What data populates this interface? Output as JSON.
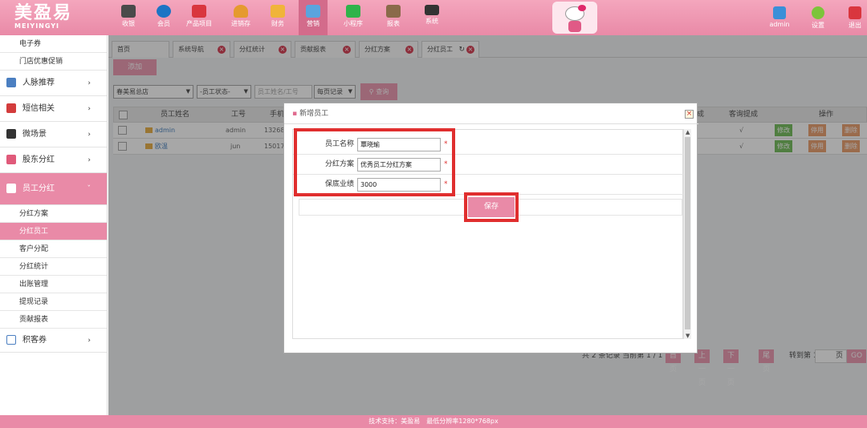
{
  "brand": {
    "logo_cn": "美盈易",
    "logo_en": "MEIYINGYI"
  },
  "topnav": [
    {
      "label": "收银",
      "icon": "cash-register-icon",
      "color": "#4a4a4a"
    },
    {
      "label": "会员",
      "icon": "member-icon",
      "color": "#1d74c4"
    },
    {
      "label": "产品项目",
      "icon": "product-icon",
      "color": "#d9363e"
    },
    {
      "label": "进销存",
      "icon": "inventory-icon",
      "color": "#e59a2f"
    },
    {
      "label": "财务",
      "icon": "finance-icon",
      "color": "#f0b43a"
    },
    {
      "label": "营销",
      "icon": "megaphone-icon",
      "color": "#5aa4de"
    },
    {
      "label": "小程序",
      "icon": "wechat-icon",
      "color": "#2fb34a"
    },
    {
      "label": "报表",
      "icon": "report-icon",
      "color": "#8a6a4a"
    },
    {
      "label": "系统",
      "icon": "monitor-icon",
      "color": "#333333"
    }
  ],
  "topright": {
    "user": "admin",
    "settings": "设置",
    "logout": "退出"
  },
  "sidebar": {
    "top_items": [
      "电子券",
      "门店优惠促销"
    ],
    "groups": [
      {
        "label": "人脉推荐",
        "icon": "network-icon",
        "color": "#4b7fc1"
      },
      {
        "label": "短信相关",
        "icon": "phone-icon",
        "color": "#d33c3c"
      },
      {
        "label": "微场景",
        "icon": "mobile-icon",
        "color": "#333333"
      },
      {
        "label": "股东分红",
        "icon": "shareholder-icon",
        "color": "#e05a7a"
      }
    ],
    "active_group": {
      "label": "员工分红",
      "icon": "employee-icon"
    },
    "sub_items": [
      "分红方案",
      "分红员工",
      "客户分配",
      "分红统计",
      "出账管理",
      "提现记录",
      "贡献报表"
    ],
    "active_sub": "分红员工",
    "bottom_group": {
      "label": "积客券",
      "icon": "coupon-icon"
    }
  },
  "tabs": [
    {
      "label": "首页",
      "closable": false
    },
    {
      "label": "系统导航",
      "closable": true
    },
    {
      "label": "分红统计",
      "closable": true
    },
    {
      "label": "贡献报表",
      "closable": true
    },
    {
      "label": "分红方案",
      "closable": true
    },
    {
      "label": "分红员工",
      "closable": true,
      "active": true
    }
  ],
  "toolbar": {
    "add": "添加"
  },
  "filters": {
    "store": "春美易总店",
    "status": "-员工状态-",
    "search_placeholder": "员工姓名/工号",
    "page_size": "每页记录",
    "query": "查询"
  },
  "table": {
    "headers": [
      "员工姓名",
      "工号",
      "手机",
      "成",
      "客询提成",
      "操作"
    ],
    "rows": [
      {
        "name": "admin",
        "id": "admin",
        "phone": "132680",
        "check": "√"
      },
      {
        "name": "欧温",
        "id": "jun",
        "phone": "150176",
        "check": "√"
      }
    ],
    "actions": {
      "edit": "修改",
      "disable": "停用",
      "delete": "删除"
    }
  },
  "pager": {
    "info": "共 2 条记录 当前第 1 / 1",
    "first": "首页",
    "prev": "上一页",
    "next": "下一页",
    "last": "尾页",
    "goto": "转到第 1",
    "page": "页",
    "go": "GO"
  },
  "modal": {
    "title": "新增员工",
    "fields": [
      {
        "label": "员工名称",
        "value": "覃晓瑜"
      },
      {
        "label": "分红方案",
        "value": "优秀员工分红方案"
      },
      {
        "label": "保底业绩",
        "value": "3000"
      }
    ],
    "required_mark": "*",
    "save": "保存"
  },
  "footer": "技术支持：美盈易　最低分辨率1280*768px"
}
